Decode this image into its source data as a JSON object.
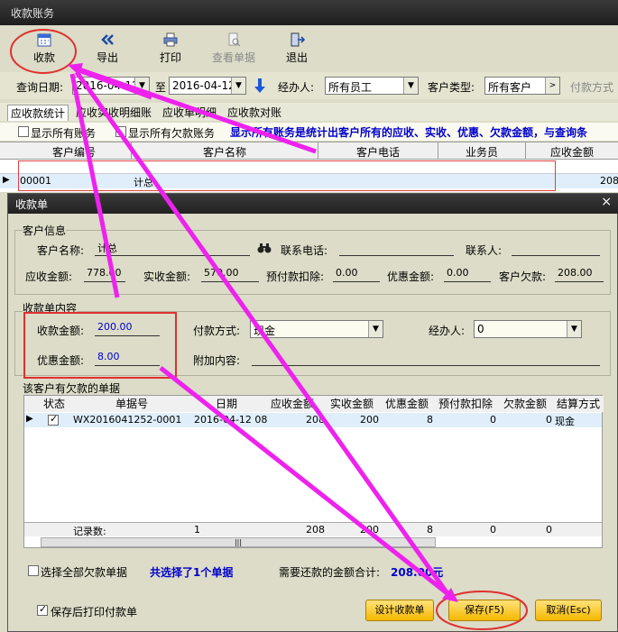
{
  "main": {
    "title": "收款账务",
    "toolbar": {
      "receive": "收款",
      "export": "导出",
      "print": "打印",
      "view": "查看单据",
      "exit": "退出"
    },
    "filter": {
      "date_label": "查询日期:",
      "date_from": "2016-04-12",
      "to_label": "至",
      "date_to": "2016-04-12",
      "handler_label": "经办人:",
      "handler_value": "所有员工",
      "customer_type_label": "客户类型:",
      "customer_type_value": "所有客户",
      "pay_method_label": "付款方式"
    },
    "tabs": [
      "应收款统计",
      "应收实收明细账",
      "应收单明细",
      "应收款对账"
    ],
    "checks": {
      "show_all_accounts": "显示所有账务",
      "show_all_debt": "显示所有欠款账务"
    },
    "notice": "显示所有账务是统计出客户所有的应收、实收、优惠、欠款金额，与查询条",
    "grid": {
      "headers": [
        "客户编号",
        "客户名称",
        "客户电话",
        "业务员",
        "应收金额"
      ],
      "row": {
        "id": "00001",
        "name": "计总",
        "amount": "208"
      }
    }
  },
  "dialog": {
    "title": "收款单",
    "close": "×",
    "customer_info": {
      "section": "客户信息",
      "name_label": "客户名称:",
      "name_value": "计总",
      "phone_label": "联系电话:",
      "phone_value": "",
      "contact_label": "联系人:",
      "contact_value": "",
      "receivable_label": "应收金额:",
      "receivable_value": "778.00",
      "received_label": "实收金额:",
      "received_value": "570.00",
      "prepaid_label": "预付款扣除:",
      "prepaid_value": "0.00",
      "discount_label": "优惠金额:",
      "discount_value": "0.00",
      "debt_label": "客户欠款:",
      "debt_value": "208.00"
    },
    "content": {
      "section": "收款单内容",
      "amount_label": "收款金额:",
      "amount_value": "200.00",
      "discount_label": "优惠金额:",
      "discount_value": "8.00",
      "pay_method_label": "付款方式:",
      "pay_method_value": "现金",
      "handler_label": "经办人:",
      "handler_value": "0",
      "extra_label": "附加内容:",
      "extra_value": ""
    },
    "bills": {
      "section": "该客户有欠款的单据",
      "headers": [
        "状态",
        "单据号",
        "日期",
        "应收金额",
        "实收金额",
        "优惠金额",
        "预付款扣除",
        "欠款金额",
        "结算方式"
      ],
      "rows": [
        {
          "bill_no": "WX2016041252-0001",
          "date": "2016-04-12 08",
          "receivable": "208",
          "received": "200",
          "discount": "8",
          "prepaid": "0",
          "debt": "0",
          "settle": "现金"
        }
      ],
      "footer": {
        "label": "记录数:",
        "count": "1",
        "receivable": "208",
        "received": "200",
        "discount": "8",
        "prepaid": "0",
        "debt": "0"
      }
    },
    "select_all": "选择全部欠款单据",
    "selected_text": "共选择了1个单据",
    "total_label": "需要还款的金额合计:",
    "total_value": "208.00元",
    "print_after_save": "保存后打印付款单",
    "design_button": "设计收款单",
    "save_button": "保存(F5)",
    "cancel_button": "取消(Esc)"
  },
  "colors": {
    "annotation": "#ee22ee",
    "circle": "#e03030",
    "accent_blue": "#0000cc",
    "button_yellow": "#f5b800"
  }
}
